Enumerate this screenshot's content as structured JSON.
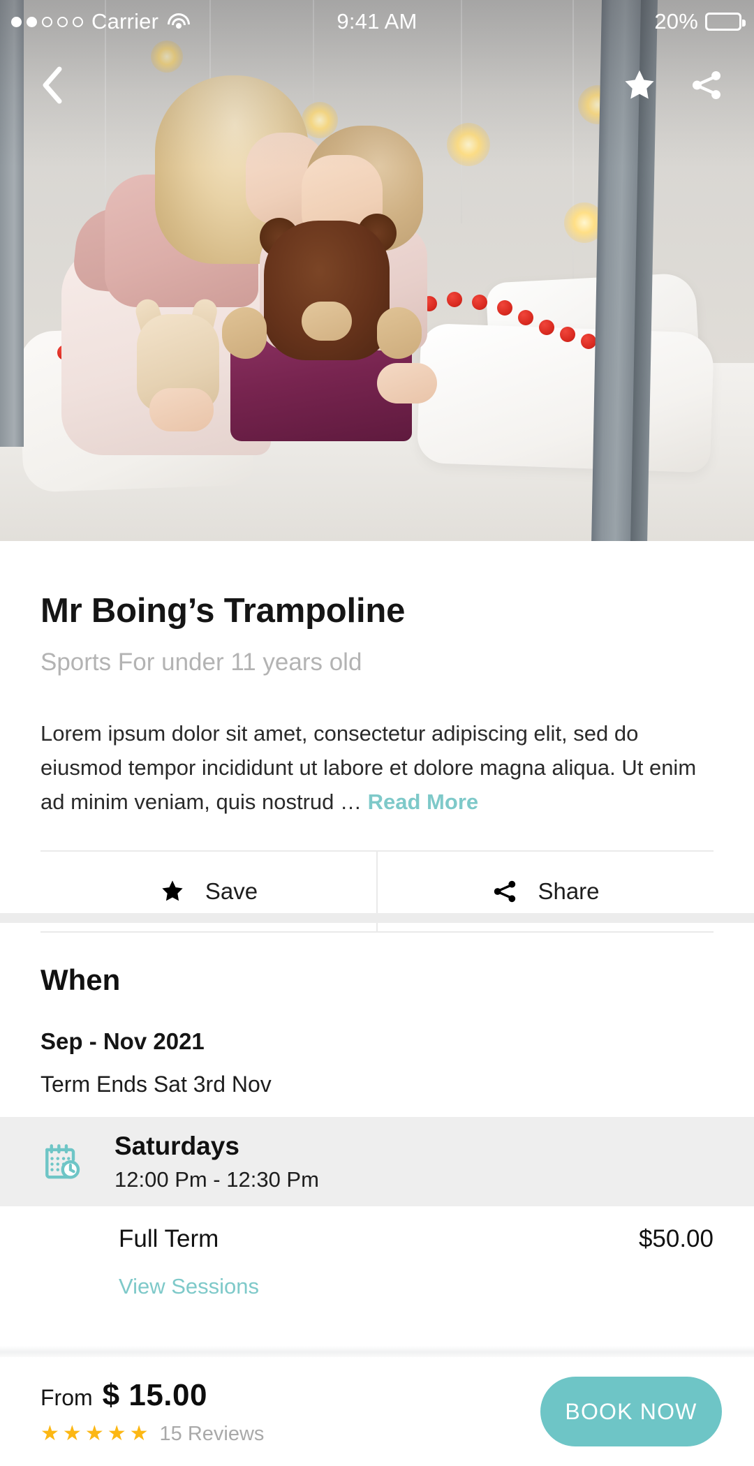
{
  "status_bar": {
    "carrier": "Carrier",
    "signal_dots_filled": 2,
    "signal_dots_total": 5,
    "wifi_icon": "wifi-icon",
    "time": "9:41 AM",
    "battery_percent": "20%",
    "battery_level": 20
  },
  "hero": {
    "back_icon": "chevron-left-icon",
    "favorite_icon": "star-icon",
    "share_icon": "share-icon",
    "photo_alt": "Two young children sitting on a bed, the older girl kissing the younger one's cheek, both holding plush toys"
  },
  "info": {
    "title": "Mr Boing’s Trampoline",
    "subtitle": "Sports For under 11 years old",
    "description": "Lorem ipsum dolor sit amet, consectetur adipiscing elit, sed do eiusmod tempor incididunt ut labore et dolore magna aliqua. Ut enim ad minim veniam, quis nostrud … ",
    "read_more": "Read More",
    "save_label": "Save",
    "save_icon": "star-icon",
    "share_label": "Share",
    "share_icon": "share-icon"
  },
  "when": {
    "heading": "When",
    "date_range": "Sep - Nov 2021",
    "term_ends": "Term Ends Sat 3rd Nov",
    "schedule": {
      "icon": "calendar-clock-icon",
      "day": "Saturdays",
      "time": "12:00 Pm - 12:30 Pm"
    },
    "pricing": {
      "label": "Full Term",
      "price": "$50.00",
      "view_sessions": "View Sessions"
    }
  },
  "bottom_bar": {
    "from_label": "From",
    "from_amount": "$ 15.00",
    "stars_filled": 5,
    "reviews": "15 Reviews",
    "book_label": "BOOK NOW"
  },
  "colors": {
    "accent_teal": "#6ec5c6",
    "link_teal": "#7ec9c9",
    "star_gold": "#fcb713",
    "band_gray": "#ececec",
    "row_gray": "#eeeeee",
    "muted_text": "#b3b3b3"
  }
}
